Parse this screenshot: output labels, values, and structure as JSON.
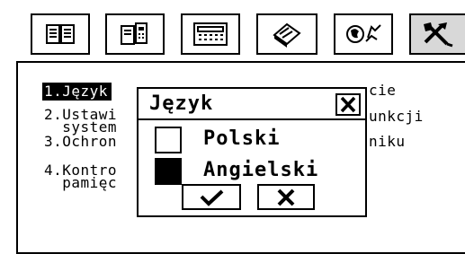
{
  "toolbar": {
    "tabs": [
      {
        "icon": "book-icon"
      },
      {
        "icon": "phonebook-icon"
      },
      {
        "icon": "calculator-icon"
      },
      {
        "icon": "organizer-icon"
      },
      {
        "icon": "games-icon"
      },
      {
        "icon": "tools-icon",
        "active": true
      }
    ]
  },
  "menu": {
    "items": [
      {
        "line1": "1.Język",
        "line2": "",
        "right": "cie"
      },
      {
        "line1": "2.Ustawi",
        "line2": "  system",
        "right": "unkcji"
      },
      {
        "line1": "3.Ochron",
        "line2": "",
        "right": "niku"
      },
      {
        "line1": "4.Kontro",
        "line2": "  pamięc",
        "right": ""
      }
    ]
  },
  "dialog": {
    "title": "Język",
    "close_label": "X",
    "options": [
      {
        "label": "Polski",
        "checked": false
      },
      {
        "label": "Angielski",
        "checked": true
      }
    ],
    "ok_icon": "checkmark-icon",
    "cancel_icon": "close-icon"
  }
}
